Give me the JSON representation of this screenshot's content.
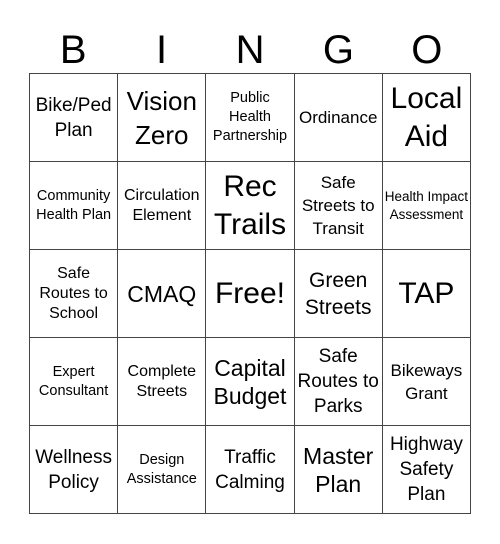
{
  "header": [
    "B",
    "I",
    "N",
    "G",
    "O"
  ],
  "cells": [
    [
      "Bike/Ped Plan",
      "Vision Zero",
      "Public Health Partnership",
      "Ordinance",
      "Local Aid"
    ],
    [
      "Community Health Plan",
      "Circulation Element",
      "Rec Trails",
      "Safe Streets to Transit",
      "Health Impact Assessment"
    ],
    [
      "Safe Routes to School",
      "CMAQ",
      "Free!",
      "Green Streets",
      "TAP"
    ],
    [
      "Expert Consultant",
      "Complete Streets",
      "Capital Budget",
      "Safe Routes to Parks",
      "Bikeways Grant"
    ],
    [
      "Wellness Policy",
      "Design Assistance",
      "Traffic Calming",
      "Master Plan",
      "Highway Safety Plan"
    ]
  ]
}
